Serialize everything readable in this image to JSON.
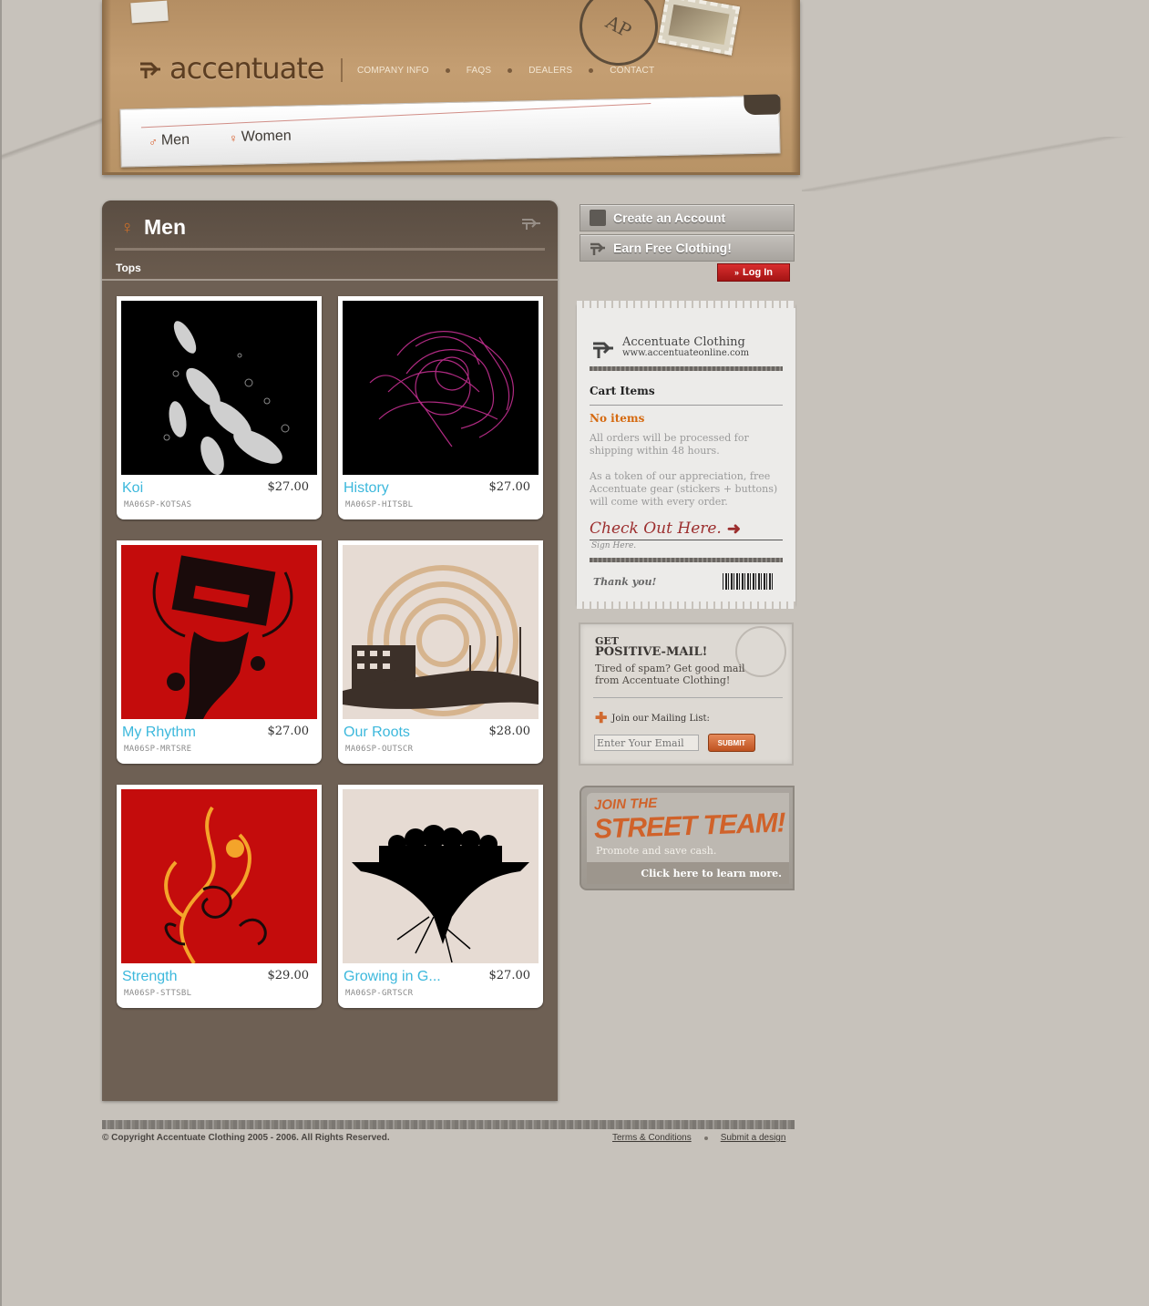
{
  "brand": {
    "logo_text": "accentuate"
  },
  "topnav": {
    "items": [
      "COMPANY INFO",
      "FAQS",
      "DEALERS",
      "CONTACT"
    ]
  },
  "gender_tabs": {
    "men": "Men",
    "women": "Women"
  },
  "main": {
    "title": "Men",
    "subtitle": "Tops"
  },
  "products": [
    {
      "name": "Koi",
      "price": "$27.00",
      "sku": "MA06SP-KOTSAS"
    },
    {
      "name": "History",
      "price": "$27.00",
      "sku": "MA06SP-HITSBL"
    },
    {
      "name": "My Rhythm",
      "price": "$27.00",
      "sku": "MA06SP-MRTSRE"
    },
    {
      "name": "Our Roots",
      "price": "$28.00",
      "sku": "MA06SP-OUTSCR"
    },
    {
      "name": "Strength",
      "price": "$29.00",
      "sku": "MA06SP-STTSBL"
    },
    {
      "name": "Growing in G...",
      "price": "$27.00",
      "sku": "MA06SP-GRTSCR"
    }
  ],
  "sidebar": {
    "create_account": "Create an Account",
    "earn_free": "Earn Free Clothing!",
    "login": "Log In",
    "cart": {
      "brand_name": "Accentuate Clothing",
      "brand_url": "www.accentuateonline.com",
      "title": "Cart Items",
      "status": "No items",
      "note1": "All orders will be processed for shipping within 48 hours.",
      "note2": "As a token of our appreciation, free Accentuate gear (stickers + buttons) will come with every order.",
      "checkout": "Check Out Here.",
      "sign_here": "Sign Here.",
      "thanks": "Thank you!"
    },
    "mailing": {
      "get": "GET",
      "title": "POSITIVE-MAIL!",
      "desc": "Tired of spam? Get good mail from Accentuate Clothing!",
      "join": "Join our Mailing List:",
      "placeholder": "Enter Your Email",
      "submit": "SUBMIT"
    },
    "street_team": {
      "line1": "JOIN THE",
      "line2": "STREET TEAM!",
      "desc": "Promote and save cash.",
      "more": "Click here to learn more."
    }
  },
  "footer": {
    "copyright": "© Copyright Accentuate Clothing 2005 - 2006. All Rights Reserved.",
    "terms": "Terms & Conditions",
    "submit_design": "Submit a design"
  },
  "colors": {
    "accent_orange": "#d5690f",
    "product_name": "#3cb8dc",
    "panel": "#6e6054",
    "login_red": "#c21f1f"
  }
}
